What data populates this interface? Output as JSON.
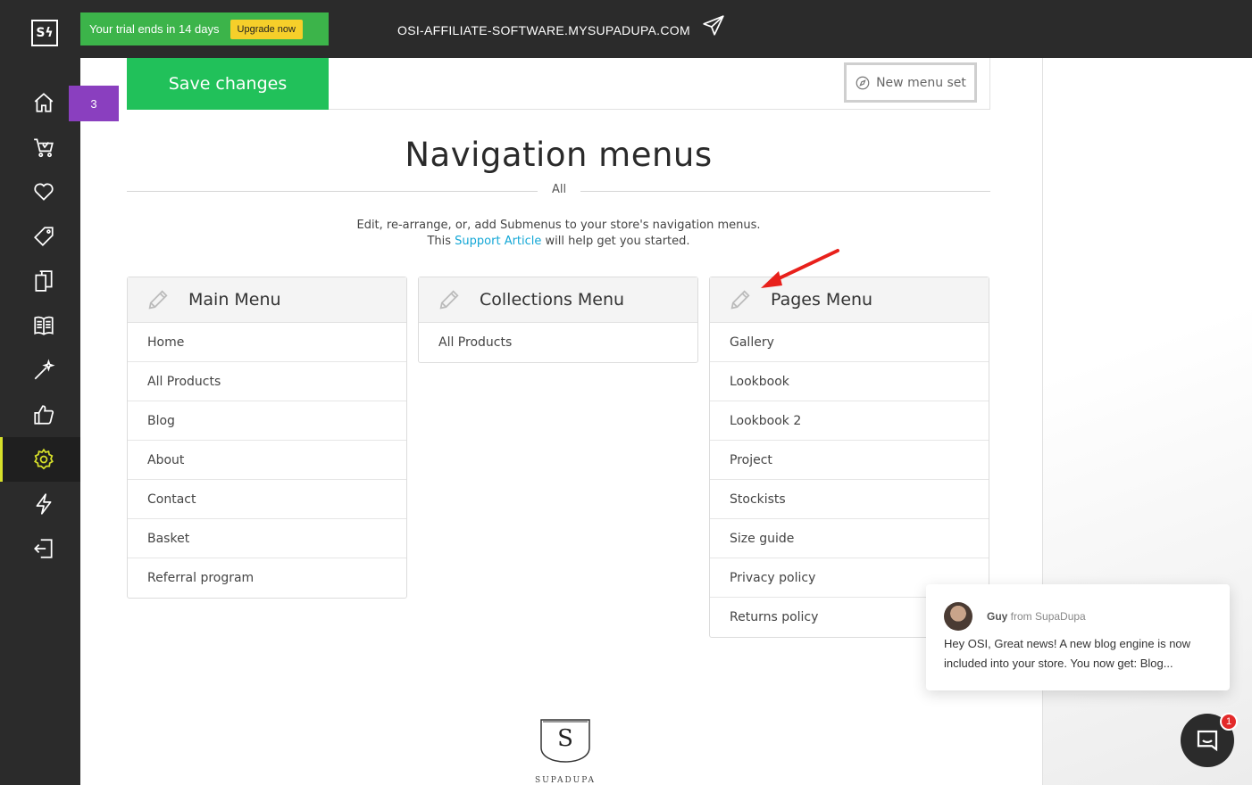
{
  "topbar": {
    "logo_text": "Sϟ",
    "trial_text": "Your trial ends in 14 days",
    "upgrade_label": "Upgrade now",
    "domain": "OSI-AFFILIATE-SOFTWARE.MYSUPADUPA.COM",
    "send_icon": "paper-plane-icon"
  },
  "sidebar": {
    "items": [
      {
        "icon": "home-icon"
      },
      {
        "icon": "basket-icon"
      },
      {
        "icon": "heart-icon"
      },
      {
        "icon": "tag-icon"
      },
      {
        "icon": "pages-icon"
      },
      {
        "icon": "book-icon"
      },
      {
        "icon": "magic-wand-icon"
      },
      {
        "icon": "thumbs-up-icon"
      },
      {
        "icon": "gear-icon",
        "active": true
      },
      {
        "icon": "lightning-icon"
      },
      {
        "icon": "logout-icon"
      }
    ],
    "active_color": "#d7e02a",
    "notification_count": "3"
  },
  "toolbar": {
    "save_label": "Save changes",
    "new_menu_label": "New menu set"
  },
  "page": {
    "title": "Navigation menus",
    "filter": "All",
    "desc_line1": "Edit, re-arrange, or, add Submenus to your store's navigation menus.",
    "desc_pre": "This ",
    "desc_link": "Support Article",
    "desc_post": " will help get you started."
  },
  "menus": [
    {
      "title": "Main Menu",
      "items": [
        "Home",
        "All Products",
        "Blog",
        "About",
        "Contact",
        "Basket",
        "Referral program"
      ]
    },
    {
      "title": "Collections Menu",
      "items": [
        "All Products"
      ]
    },
    {
      "title": "Pages Menu",
      "items": [
        "Gallery",
        "Lookbook",
        "Lookbook 2",
        "Project",
        "Stockists",
        "Size guide",
        "Privacy policy",
        "Returns policy"
      ]
    }
  ],
  "chat": {
    "sender_name": "Guy",
    "sender_from": " from SupaDupa",
    "message": "Hey OSI, Great news! A new blog engine is now included into your store.  You now get: Blog...",
    "unread": "1"
  },
  "footer": {
    "logo_letter": "S",
    "brand": "SUPADUPA"
  },
  "colors": {
    "save_green": "#21c15a",
    "trial_green": "#3cb44a",
    "upgrade_yellow": "#f6cf2a",
    "link_blue": "#13a7d6",
    "badge_purple": "#8a3fbf",
    "annotation_red": "#e8201b"
  }
}
